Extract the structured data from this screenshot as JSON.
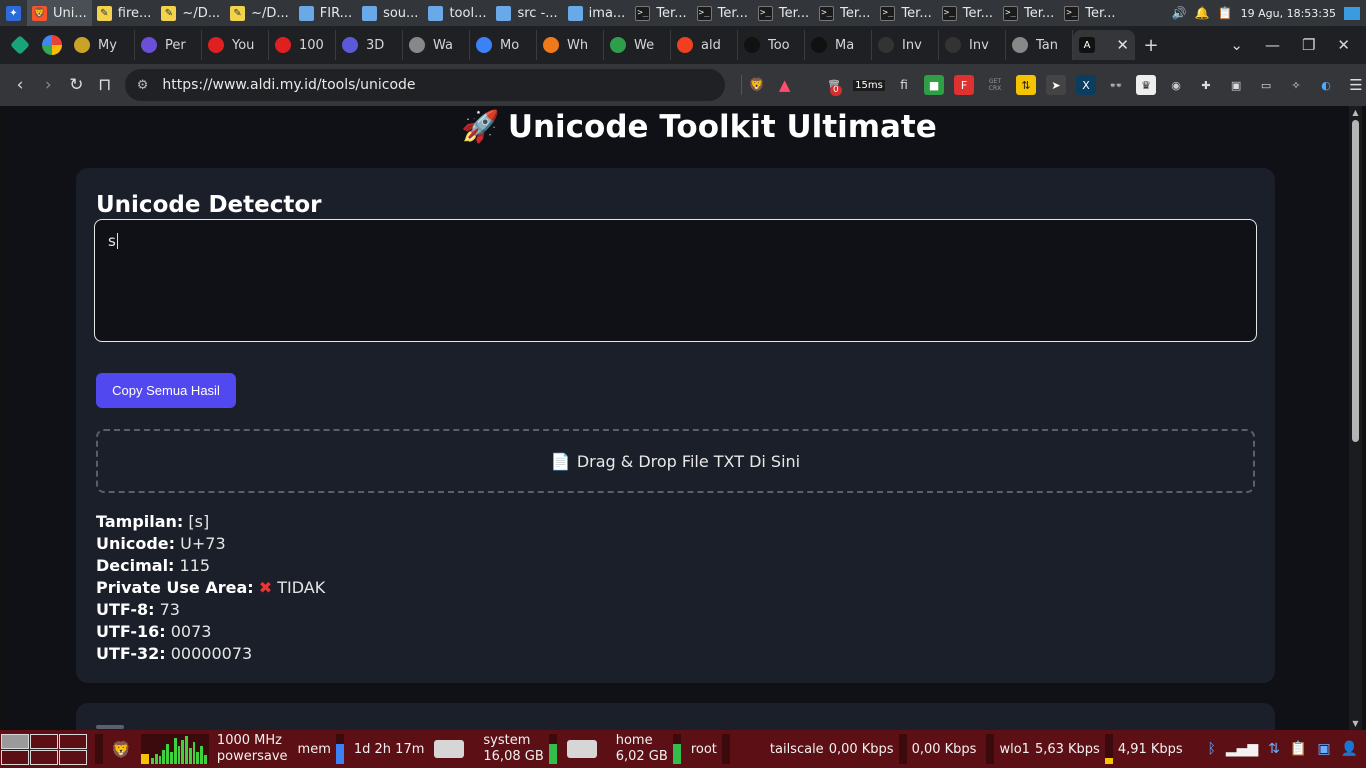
{
  "top_panel": {
    "tasks": [
      {
        "label": "Uni...",
        "icon": "brave-icon",
        "active": true
      },
      {
        "label": "fire...",
        "icon": "note-icon"
      },
      {
        "label": "~/D...",
        "icon": "note-icon"
      },
      {
        "label": "~/D...",
        "icon": "note-icon"
      },
      {
        "label": "FIR...",
        "icon": "folder-icon"
      },
      {
        "label": "sou...",
        "icon": "folder-icon"
      },
      {
        "label": "tool...",
        "icon": "folder-icon"
      },
      {
        "label": "src -...",
        "icon": "folder-icon"
      },
      {
        "label": "ima...",
        "icon": "folder-icon"
      },
      {
        "label": "Ter...",
        "icon": "terminal-icon"
      },
      {
        "label": "Ter...",
        "icon": "terminal-icon"
      },
      {
        "label": "Ter...",
        "icon": "terminal-icon"
      },
      {
        "label": "Ter...",
        "icon": "terminal-icon"
      },
      {
        "label": "Ter...",
        "icon": "terminal-icon"
      },
      {
        "label": "Ter...",
        "icon": "terminal-icon"
      },
      {
        "label": "Ter...",
        "icon": "terminal-icon"
      },
      {
        "label": "Ter...",
        "icon": "terminal-icon"
      }
    ],
    "clock": "19 Agu, 18:53:35"
  },
  "tabs": {
    "items": [
      {
        "label": "My",
        "color": "#c9a227"
      },
      {
        "label": "Per",
        "color": "#6b4fd8"
      },
      {
        "label": "You",
        "color": "#e02020"
      },
      {
        "label": "100",
        "color": "#e02020"
      },
      {
        "label": "3D",
        "color": "#5a5ad8"
      },
      {
        "label": "Wa",
        "color": "#888888"
      },
      {
        "label": "Mo",
        "color": "#3b82f6"
      },
      {
        "label": "Wh",
        "color": "#f07a1a"
      },
      {
        "label": "We",
        "color": "#2e9e4a"
      },
      {
        "label": "ald",
        "color": "#f04020"
      },
      {
        "label": "Too",
        "color": "#111111"
      },
      {
        "label": "Ma",
        "color": "#111111"
      },
      {
        "label": "Inv",
        "color": "#333333"
      },
      {
        "label": "Inv",
        "color": "#333333"
      },
      {
        "label": "Tan",
        "color": "#888888"
      }
    ]
  },
  "toolbar": {
    "url": "https://www.aldi.my.id/tools/unicode",
    "ext_badge": "0",
    "ext_ping": "15ms",
    "ext_crx": "GET CRX"
  },
  "page": {
    "title": "Unicode Toolkit Ultimate",
    "detector": {
      "title": "Unicode Detector",
      "input_value": "s",
      "copy_label": "Copy Semua Hasil",
      "dropzone_label": "Drag & Drop File TXT Di Sini"
    },
    "results": {
      "display": {
        "label": "Tampilan:",
        "value": "[s]"
      },
      "unicode": {
        "label": "Unicode:",
        "value": "U+73"
      },
      "decimal": {
        "label": "Decimal:",
        "value": "115"
      },
      "pua": {
        "label": "Private Use Area:",
        "value": "TIDAK"
      },
      "utf8": {
        "label": "UTF-8:",
        "value": "73"
      },
      "utf16": {
        "label": "UTF-16:",
        "value": "0073"
      },
      "utf32": {
        "label": "UTF-32:",
        "value": "00000073"
      }
    }
  },
  "bottom_panel": {
    "cpu_freq": "1000 MHz",
    "cpu_governor": "powersave",
    "mem_label": "mem",
    "uptime": "1d 2h 17m",
    "system_label": "system",
    "system_size": "16,08 GB",
    "home_label": "home",
    "home_size": "6,02 GB",
    "root_label": "root",
    "tailscale_label": "tailscale",
    "tailscale_down": "0,00 Kbps",
    "tailscale_up": "0,00 Kbps",
    "wlo1_label": "wlo1",
    "wlo1_down": "5,63 Kbps",
    "wlo1_up": "4,91 Kbps"
  }
}
